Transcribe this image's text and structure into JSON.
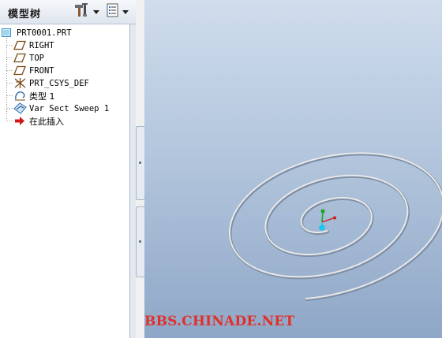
{
  "panel": {
    "title": "模型树",
    "settings_icon": "tree-settings-icon",
    "show_icon": "show-list-icon"
  },
  "tree": {
    "items": [
      {
        "label": "PRT0001.PRT",
        "icon": "part-icon"
      },
      {
        "label": "RIGHT",
        "icon": "datum-plane-icon"
      },
      {
        "label": "TOP",
        "icon": "datum-plane-icon"
      },
      {
        "label": "FRONT",
        "icon": "datum-plane-icon"
      },
      {
        "label": "PRT_CSYS_DEF",
        "icon": "csys-icon"
      },
      {
        "label": "类型 1",
        "icon": "curve-icon"
      },
      {
        "label": "Var Sect Sweep 1",
        "icon": "sweep-icon"
      },
      {
        "label": "在此插入",
        "icon": "insert-here-arrow-icon"
      }
    ]
  },
  "viewport": {
    "watermark": "BBS.CHINADE.NET",
    "colors": {
      "watermark": "#e0302a",
      "spiral": "#e8e8e8"
    }
  }
}
